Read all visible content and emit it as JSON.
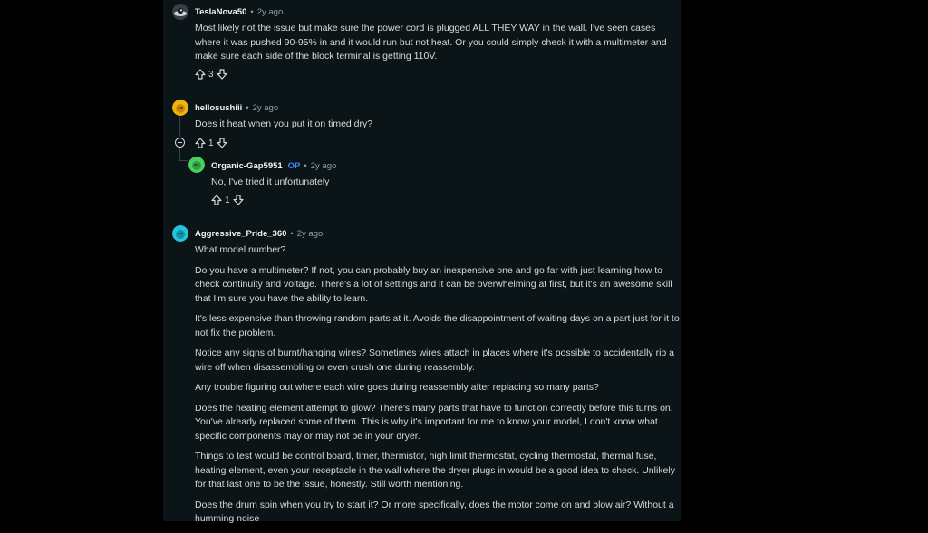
{
  "comments": [
    {
      "author": "TeslaNova50",
      "time": "2y ago",
      "body": [
        "Most likely not the issue but make sure the power cord is plugged ALL THEY WAY in the wall. I've seen cases where it was pushed 90-95% in and it would run but not heat. Or you could simply check it with a multimeter and make sure each side of the block terminal is getting 110V."
      ],
      "votes": "3"
    },
    {
      "author": "hellosushiii",
      "time": "2y ago",
      "body": [
        "Does it heat when you put it on timed dry?"
      ],
      "votes": "1"
    },
    {
      "author": "Organic-Gap5951",
      "op_badge": "OP",
      "time": "2y ago",
      "body": [
        "No, I've tried it unfortunately"
      ],
      "votes": "1"
    },
    {
      "author": "Aggressive_Pride_360",
      "time": "2y ago",
      "body": [
        "What model number?",
        "Do you have a multimeter? If not, you can probably buy an inexpensive one and go far with just learning how to check continuity and voltage. There's a lot of settings and it can be overwhelming at first, but it's an awesome skill that I'm sure you have the ability to learn.",
        "It's less expensive than throwing random parts at it. Avoids the disappointment of waiting days on a part just for it to not fix the problem.",
        "Notice any signs of burnt/hanging wires? Sometimes wires attach in places where it's possible to accidentally rip a wire off when disassembling or even crush one during reassembly.",
        "Any trouble figuring out where each wire goes during reassembly after replacing so many parts?",
        "Does the heating element attempt to glow? There's many parts that have to function correctly before this turns on. You've already replaced some of them. This is why it's important for me to know your model, I don't know what specific components may or may not be in your dryer.",
        "Things to test would be control board, timer, thermistor, high limit thermostat, cycling thermostat, thermal fuse, heating element, even your receptacle in the wall where the dryer plugs in would be a good idea to check. Unlikely for that last one to be the issue, honestly. Still worth mentioning.",
        "Does the drum spin when you try to start it? Or more specifically, does the motor come on and blow air? Without a humming noise"
      ]
    }
  ],
  "separator": "•",
  "colors": {
    "op": "#3d8bff",
    "background": "#0b1416",
    "text": "#d7dadc"
  }
}
